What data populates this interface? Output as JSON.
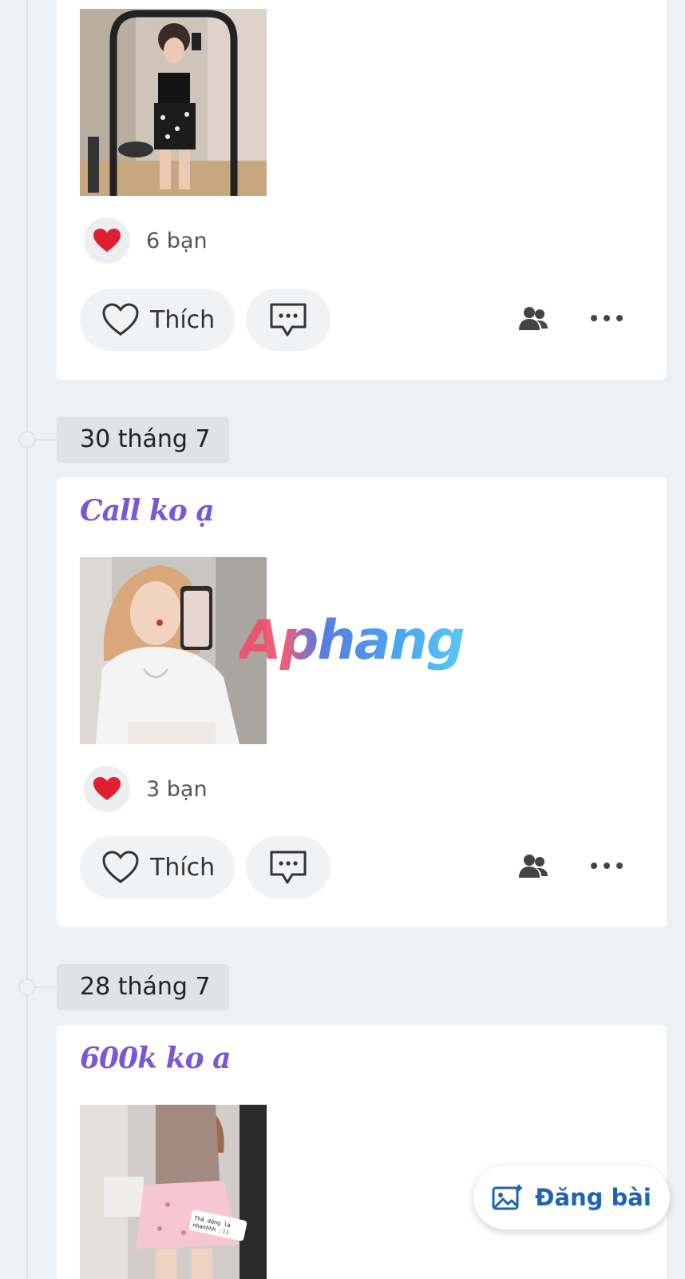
{
  "posts": [
    {
      "title": "",
      "reaction_count": "6 bạn",
      "like_label": "Thích",
      "photo": "mirror-selfie-black-outfit"
    },
    {
      "date": "30 tháng 7",
      "title": "Call ko ạ",
      "reaction_count": "3 bạn",
      "like_label": "Thích",
      "photo": "selfie-white-top"
    },
    {
      "date": "28 tháng 7",
      "title": "600k ko a",
      "photo": "mirror-selfie-pink-skirt",
      "photo_caption": "Thả dáng là nhanhhh :))"
    }
  ],
  "fab": {
    "label": "Đăng bài",
    "icon": "image-plus-icon",
    "color": "#1e63b8"
  },
  "watermark": "Aphang",
  "colors": {
    "title_purple": "#7b57d6",
    "heart_red": "#e02030",
    "background": "#eef1f4"
  }
}
